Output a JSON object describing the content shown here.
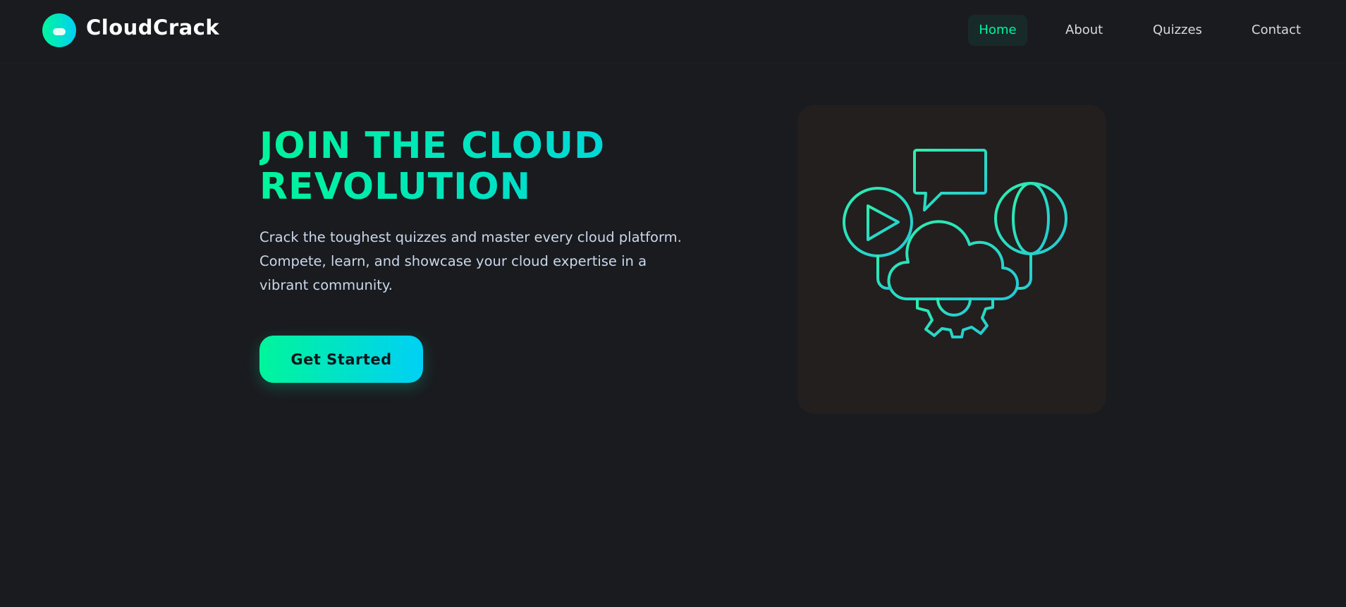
{
  "brand": {
    "name": "CloudCrack",
    "icon": "cloud-logo-icon",
    "gradient": [
      "#00f59b",
      "#00d0f5"
    ]
  },
  "nav": {
    "items": [
      {
        "label": "Home",
        "active": true
      },
      {
        "label": "About",
        "active": false
      },
      {
        "label": "Quizzes",
        "active": false
      },
      {
        "label": "Contact",
        "active": false
      }
    ]
  },
  "hero": {
    "title": "JOIN THE CLOUD REVOLUTION",
    "description": "Crack the toughest quizzes and master every cloud platform. Compete, learn, and showcase your cloud expertise in a vibrant community.",
    "cta_label": "Get Started",
    "illustration": "cloud-network-icon"
  },
  "colors": {
    "accent": "#00f59b",
    "accent2": "#00d0f5",
    "background": "#1a1b1f",
    "card": "#231f1f"
  }
}
